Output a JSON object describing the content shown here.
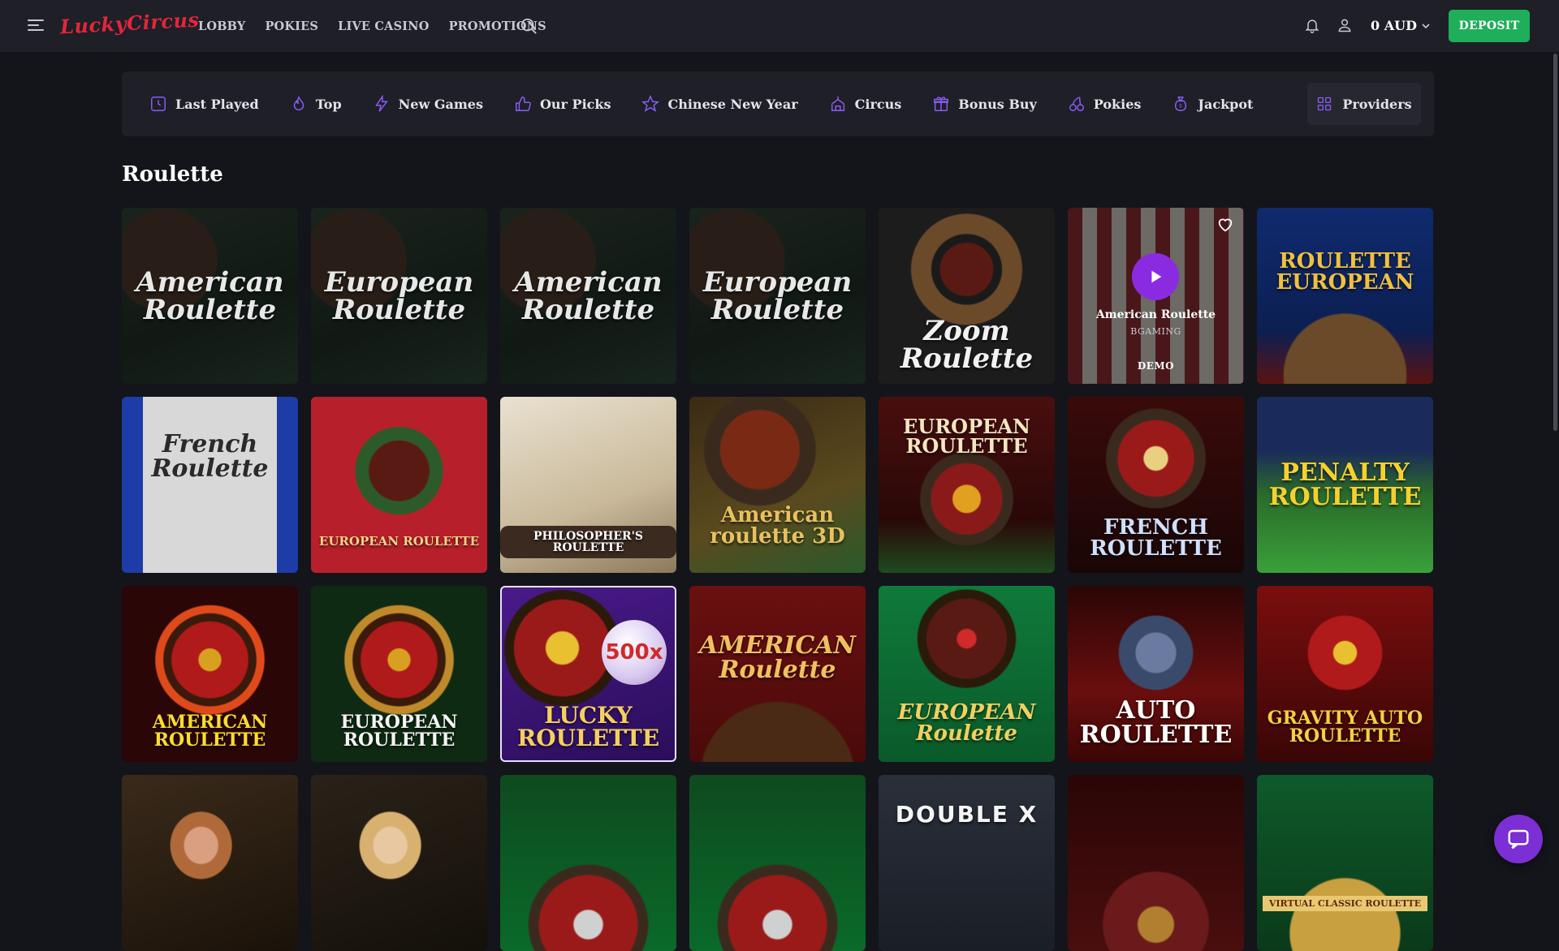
{
  "brand": {
    "logo_text": "LuckyCircus"
  },
  "nav": {
    "items": [
      {
        "label": "LOBBY"
      },
      {
        "label": "POKIES"
      },
      {
        "label": "LIVE CASINO"
      },
      {
        "label": "PROMOTIONS"
      }
    ]
  },
  "account": {
    "balance": "0 AUD",
    "deposit_label": "DEPOSIT"
  },
  "categories": {
    "items": [
      {
        "label": "Last Played",
        "icon": "clock-icon"
      },
      {
        "label": "Top",
        "icon": "flame-icon"
      },
      {
        "label": "New Games",
        "icon": "lightning-icon"
      },
      {
        "label": "Our Picks",
        "icon": "thumbs-up-icon"
      },
      {
        "label": "Chinese New Year",
        "icon": "star-icon"
      },
      {
        "label": "Circus",
        "icon": "circus-tent-icon"
      },
      {
        "label": "Bonus Buy",
        "icon": "gift-icon"
      },
      {
        "label": "Pokies",
        "icon": "cherries-icon"
      },
      {
        "label": "Jackpot",
        "icon": "coin-bag-icon"
      }
    ],
    "providers_label": "Providers"
  },
  "section": {
    "title": "Roulette"
  },
  "games": [
    {
      "name": "American Roulette",
      "theme": "felt-dark"
    },
    {
      "name": "European Roulette",
      "theme": "felt-dark"
    },
    {
      "name": "American Roulette",
      "theme": "felt-dark"
    },
    {
      "name": "European Roulette",
      "theme": "felt-dark"
    },
    {
      "name": "Zoom Roulette",
      "theme": "black-wheel"
    },
    {
      "name": "American Roulette",
      "theme": "stripes"
    },
    {
      "name": "ROULETTE EUROPEAN",
      "theme": "blue-gold"
    },
    {
      "name": "French Roulette",
      "theme": "curtain"
    },
    {
      "name": "EUROPEAN ROULETTE",
      "theme": "red-frame"
    },
    {
      "name": "PHILOSOPHER'S ROULETTE",
      "theme": "marble"
    },
    {
      "name": "American roulette 3D",
      "theme": "brown-3d"
    },
    {
      "name": "EUROPEAN ROULETTE",
      "theme": "green-table"
    },
    {
      "name": "FRENCH ROULETTE",
      "theme": "crimson"
    },
    {
      "name": "PENALTY ROULETTE",
      "theme": "stadium"
    },
    {
      "name": "AMERICAN ROULETTE",
      "theme": "red-glow"
    },
    {
      "name": "EUROPEAN ROULETTE",
      "theme": "green-glow"
    },
    {
      "name": "LUCKY ROULETTE",
      "theme": "purple"
    },
    {
      "name": "AMERICAN Roulette",
      "theme": "maroon"
    },
    {
      "name": "EUROPEAN Roulette",
      "theme": "emerald"
    },
    {
      "name": "AUTO ROULETTE",
      "theme": "dark-red"
    },
    {
      "name": "GRAVITY AUTO ROULETTE",
      "theme": "fire"
    },
    {
      "name": "",
      "theme": "live-dealer"
    },
    {
      "name": "",
      "theme": "live-dealer"
    },
    {
      "name": "",
      "theme": "green-felt"
    },
    {
      "name": "",
      "theme": "green-felt"
    },
    {
      "name": "DOUBLE X",
      "theme": "slate"
    },
    {
      "name": "",
      "theme": "dark-red"
    },
    {
      "name": "VIRTUAL CLASSIC ROULETTE",
      "theme": "green-gold"
    }
  ],
  "hover_card": {
    "title": "American Roulette",
    "provider": "BGAMING",
    "demo_label": "DEMO"
  },
  "badges": {
    "multiplier": "500x"
  },
  "colors": {
    "accent": "#1fae5a",
    "brand": "#e2263c",
    "play": "#8a2be2",
    "chat": "#7b2fd4"
  }
}
